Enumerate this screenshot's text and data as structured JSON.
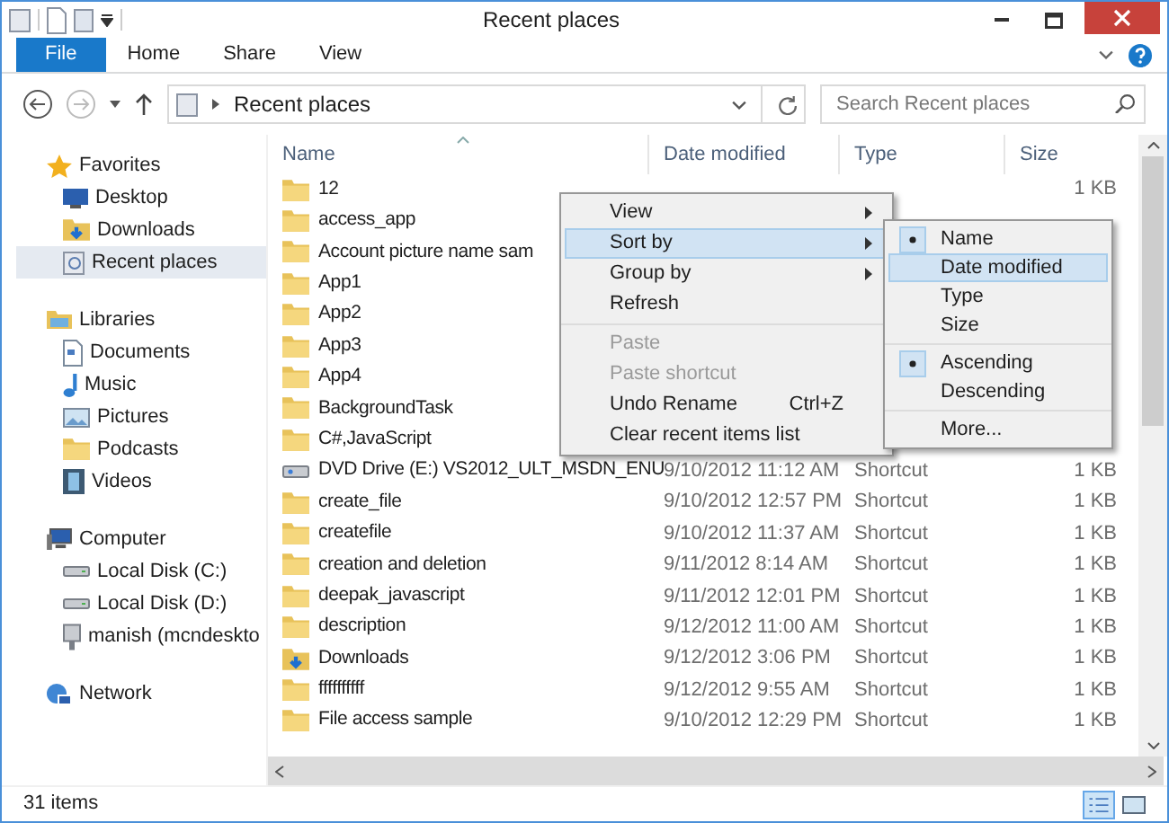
{
  "window": {
    "title": "Recent places"
  },
  "ribbon": {
    "tabs": [
      {
        "label": "File",
        "kind": "file"
      },
      {
        "label": "Home",
        "kind": "tab"
      },
      {
        "label": "Share",
        "kind": "tab"
      },
      {
        "label": "View",
        "kind": "tab"
      }
    ]
  },
  "address_bar": {
    "path": "Recent places",
    "search": {
      "placeholder": "Search Recent places"
    }
  },
  "sidebar": {
    "groups": [
      {
        "label": "Favorites",
        "kind": "star",
        "children": [
          {
            "label": "Desktop",
            "kind": "desktop",
            "selected": false
          },
          {
            "label": "Downloads",
            "kind": "downloads",
            "selected": false
          },
          {
            "label": "Recent places",
            "kind": "recent",
            "selected": true
          }
        ]
      },
      {
        "label": "Libraries",
        "kind": "libraries",
        "children": [
          {
            "label": "Documents",
            "kind": "document",
            "selected": false
          },
          {
            "label": "Music",
            "kind": "music",
            "selected": false
          },
          {
            "label": "Pictures",
            "kind": "pictures",
            "selected": false
          },
          {
            "label": "Podcasts",
            "kind": "folder",
            "selected": false
          },
          {
            "label": "Videos",
            "kind": "video",
            "selected": false
          }
        ]
      },
      {
        "label": "Computer",
        "kind": "computer",
        "children": [
          {
            "label": "Local Disk (C:)",
            "kind": "disk",
            "selected": false
          },
          {
            "label": "Local Disk (D:)",
            "kind": "disk",
            "selected": false
          },
          {
            "label": "manish (mcndeskto",
            "kind": "netdrive",
            "selected": false
          }
        ]
      },
      {
        "label": "Network",
        "kind": "network"
      }
    ]
  },
  "table": {
    "columns": [
      "Name",
      "Date modified",
      "Type",
      "Size"
    ],
    "rows": [
      {
        "kind": "folder",
        "name": "12",
        "size": "1 KB"
      },
      {
        "kind": "folder",
        "name": "access_app"
      },
      {
        "kind": "folder",
        "name": "Account picture name sam"
      },
      {
        "kind": "folder",
        "name": "App1"
      },
      {
        "kind": "folder",
        "name": "App2"
      },
      {
        "kind": "folder",
        "name": "App3"
      },
      {
        "kind": "folder",
        "name": "App4"
      },
      {
        "kind": "folder",
        "name": "BackgroundTask"
      },
      {
        "kind": "folder",
        "name": "C#,JavaScript"
      },
      {
        "kind": "dvd",
        "name": "DVD Drive (E:) VS2012_ULT_MSDN_ENU",
        "date": "9/10/2012 11:12 AM",
        "type": "Shortcut",
        "size": "1 KB"
      },
      {
        "kind": "folder",
        "name": "create_file",
        "date": "9/10/2012 12:57 PM",
        "type": "Shortcut",
        "size": "1 KB"
      },
      {
        "kind": "folder",
        "name": "createfile",
        "date": "9/10/2012 11:37 AM",
        "type": "Shortcut",
        "size": "1 KB"
      },
      {
        "kind": "folder",
        "name": "creation and deletion",
        "date": "9/11/2012 8:14 AM",
        "type": "Shortcut",
        "size": "1 KB"
      },
      {
        "kind": "folder",
        "name": "deepak_javascript",
        "date": "9/11/2012 12:01 PM",
        "type": "Shortcut",
        "size": "1 KB"
      },
      {
        "kind": "folder",
        "name": "description",
        "date": "9/12/2012 11:00 AM",
        "type": "Shortcut",
        "size": "1 KB"
      },
      {
        "kind": "downloads",
        "name": "Downloads",
        "date": "9/12/2012 3:06 PM",
        "type": "Shortcut",
        "size": "1 KB"
      },
      {
        "kind": "folder",
        "name": "ffffffffff",
        "date": "9/12/2012 9:55 AM",
        "type": "Shortcut",
        "size": "1 KB"
      },
      {
        "kind": "folder",
        "name": "File access sample",
        "date": "9/10/2012 12:29 PM",
        "type": "Shortcut",
        "size": "1 KB"
      }
    ]
  },
  "context_menu": {
    "groups": [
      [
        {
          "label": "View",
          "submenu": true,
          "disabled": false,
          "selected": false
        },
        {
          "label": "Sort by",
          "submenu": true,
          "disabled": false,
          "selected": true
        },
        {
          "label": "Group by",
          "submenu": true,
          "disabled": false,
          "selected": false
        },
        {
          "label": "Refresh",
          "submenu": false,
          "disabled": false,
          "selected": false
        }
      ],
      [
        {
          "label": "Paste",
          "submenu": false,
          "disabled": true,
          "selected": false
        },
        {
          "label": "Paste shortcut",
          "submenu": false,
          "disabled": true,
          "selected": false
        },
        {
          "label": "Undo Rename",
          "shortcut": "Ctrl+Z",
          "submenu": false,
          "disabled": false,
          "selected": false
        },
        {
          "label": "Clear recent items list",
          "submenu": false,
          "disabled": false,
          "selected": false
        }
      ]
    ]
  },
  "sort_submenu": {
    "groups": [
      [
        {
          "label": "Name",
          "checked": true,
          "selected": false
        },
        {
          "label": "Date modified",
          "checked": false,
          "selected": true
        },
        {
          "label": "Type",
          "checked": false,
          "selected": false
        },
        {
          "label": "Size",
          "checked": false,
          "selected": false
        }
      ],
      [
        {
          "label": "Ascending",
          "checked": true,
          "selected": false
        },
        {
          "label": "Descending",
          "checked": false,
          "selected": false
        }
      ],
      [
        {
          "label": "More...",
          "checked": false,
          "selected": false
        }
      ]
    ]
  },
  "status_bar": {
    "count": "31 items"
  }
}
